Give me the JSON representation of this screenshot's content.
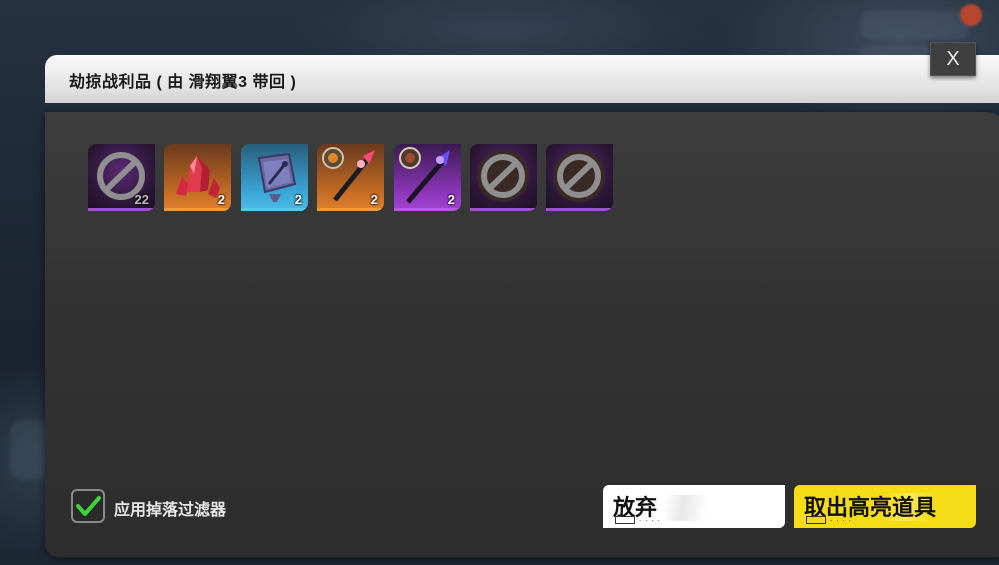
{
  "dialog": {
    "title": "劫掠战利品 ( 由 滑翔翼3 带回 )",
    "close_label": "X"
  },
  "loot_items": [
    {
      "icon": "blocked-icon",
      "rarity": "purple",
      "count": "22"
    },
    {
      "icon": "red-crystal-icon",
      "rarity": "orange",
      "count": "2"
    },
    {
      "icon": "blueprint-scroll-icon",
      "rarity": "blue",
      "count": "2"
    },
    {
      "icon": "fire-spear-icon",
      "rarity": "orange",
      "count": "2"
    },
    {
      "icon": "arcane-staff-icon",
      "rarity": "violet",
      "count": "2"
    },
    {
      "icon": "blocked-icon",
      "rarity": "purple",
      "count": ""
    },
    {
      "icon": "blocked-icon",
      "rarity": "purple",
      "count": ""
    }
  ],
  "filter": {
    "label": "应用掉落过滤器",
    "checked": true
  },
  "buttons": {
    "abandon_label": "放弃",
    "take_label": "取出高亮道具"
  },
  "colors": {
    "accent_yellow": "#f5dc14",
    "check_green": "#3ed43a",
    "rarity_purple": "#a44ed0",
    "rarity_orange": "#f09a3a",
    "rarity_blue": "#58c8f0"
  }
}
